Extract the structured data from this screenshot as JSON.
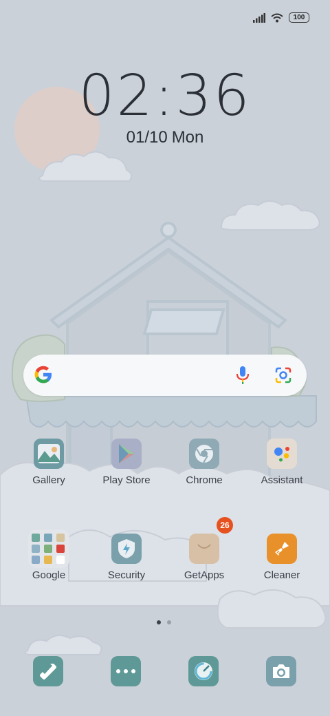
{
  "status_bar": {
    "battery": "100"
  },
  "lock": {
    "time": "02:36",
    "date": "01/10",
    "weekday": "Mon"
  },
  "apps": [
    {
      "label": "Gallery"
    },
    {
      "label": "Play Store"
    },
    {
      "label": "Chrome"
    },
    {
      "label": "Assistant"
    },
    {
      "label": "Google"
    },
    {
      "label": "Security"
    },
    {
      "label": "GetApps",
      "badge": "26"
    },
    {
      "label": "Cleaner"
    }
  ],
  "pager": {
    "pages": 2,
    "current": 1
  },
  "dock": [
    "phone-icon",
    "more-icon",
    "browser-icon",
    "camera-icon"
  ],
  "colors": {
    "background": "#cbd1d9",
    "dock_teal": "#5f9997",
    "badge": "#e6521f",
    "cleaner": "#e8912a"
  }
}
